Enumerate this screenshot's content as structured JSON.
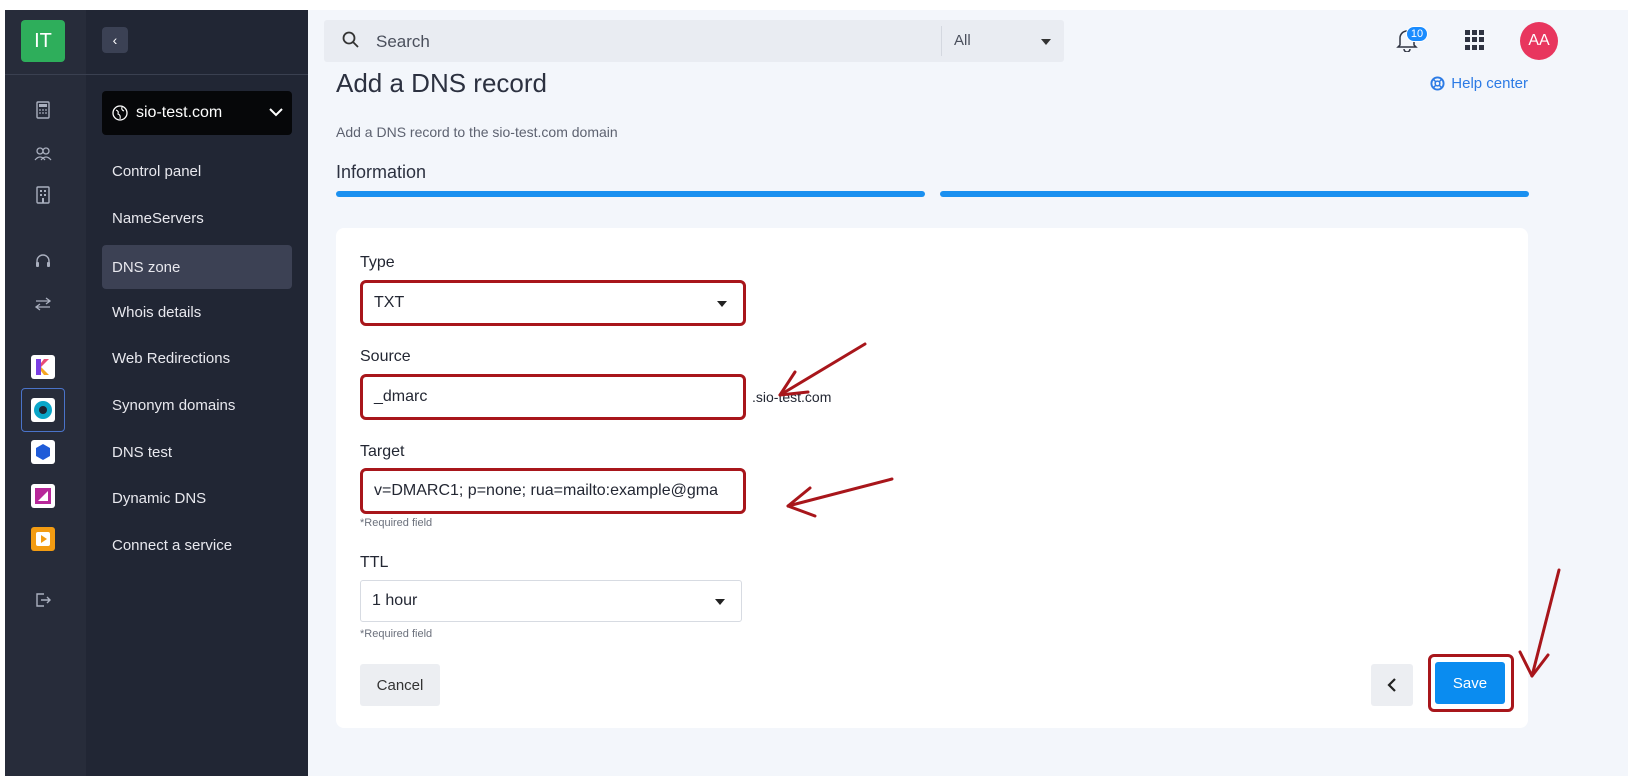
{
  "rail": {
    "logo": "IT",
    "icons": [
      "calculator-icon",
      "users-icon",
      "building-icon",
      "headset-icon",
      "transfer-icon"
    ],
    "apps": [
      {
        "name": "app-k-icon",
        "color": "#7b3fe4"
      },
      {
        "name": "app-circle-icon",
        "color": "#0aa6c9"
      },
      {
        "name": "app-cube-icon",
        "color": "#1f5bd8"
      },
      {
        "name": "app-purple-icon",
        "color": "#b7289a"
      },
      {
        "name": "app-play-icon",
        "color": "#f39c12"
      }
    ],
    "logout_icon": "logout-icon"
  },
  "sidebar": {
    "collapse_icon": "chevron-left-icon",
    "domain": "sio-test.com",
    "items": [
      {
        "label": "Control panel"
      },
      {
        "label": "NameServers"
      },
      {
        "label": "DNS zone"
      },
      {
        "label": "Whois details"
      },
      {
        "label": "Web Redirections"
      },
      {
        "label": "Synonym domains"
      },
      {
        "label": "DNS test"
      },
      {
        "label": "Dynamic DNS"
      },
      {
        "label": "Connect a service"
      }
    ],
    "active": "DNS zone"
  },
  "topbar": {
    "search_placeholder": "Search",
    "filter": "All",
    "notifications": "10",
    "avatar": "AA"
  },
  "page": {
    "title": "Add a DNS record",
    "help": "Help center",
    "subtitle": "Add a DNS record to the sio-test.com domain",
    "section": "Information"
  },
  "form": {
    "type_label": "Type",
    "type_value": "TXT",
    "source_label": "Source",
    "source_value": "_dmarc",
    "source_suffix": ".sio-test.com",
    "target_label": "Target",
    "target_value": "v=DMARC1; p=none; rua=mailto:example@gma",
    "target_hint": "*Required field",
    "ttl_label": "TTL",
    "ttl_value": "1 hour",
    "ttl_hint": "*Required field"
  },
  "actions": {
    "cancel": "Cancel",
    "save": "Save"
  },
  "colors": {
    "accent": "#0a8cf0",
    "annotation": "#a8161b",
    "sidebar_bg": "#212634"
  }
}
